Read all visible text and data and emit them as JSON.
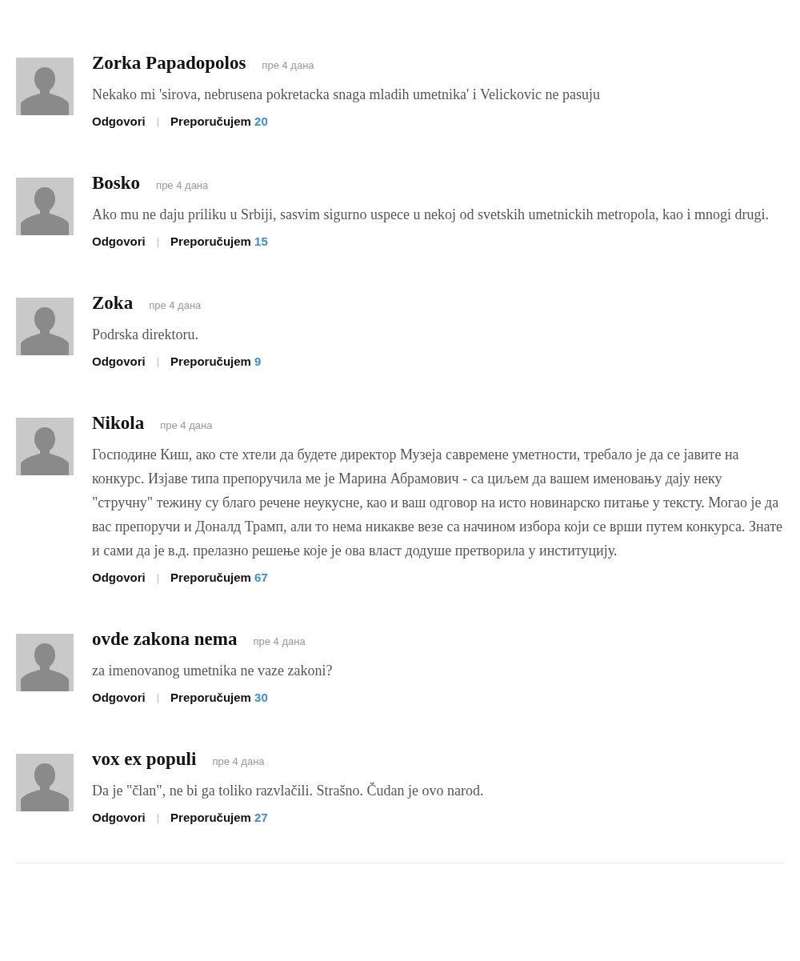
{
  "comments": [
    {
      "author": "Zorka Papadopolos",
      "time": "пре 4 дана",
      "text": "Nekako mi 'sirova, nebrusena pokretacka snaga mladih umetnika' i Velickovic ne pasuju",
      "reply": "Odgovori",
      "separator": "|",
      "recommend": "Preporučujem",
      "count": "20"
    },
    {
      "author": "Bosko",
      "time": "пре 4 дана",
      "text": "Ako mu ne daju priliku u Srbiji, sasvim sigurno uspece u nekoj od svetskih umetnickih metropola, kao i mnogi drugi.",
      "reply": "Odgovori",
      "separator": "|",
      "recommend": "Preporučujem",
      "count": "15"
    },
    {
      "author": "Zoka",
      "time": "пре 4 дана",
      "text": "Podrska direktoru.",
      "reply": "Odgovori",
      "separator": "|",
      "recommend": "Preporučujem",
      "count": "9"
    },
    {
      "author": "Nikola",
      "time": "пре 4 дана",
      "text": "Господине Киш, ако сте хтели да будете директор Музеја савремене уметности, требало је да се јавите на конкурс. Изјаве типа препоручила ме је Марина Абрамович - са циљем да вашем именовању дају неку \"стручну\" тежину су благо речене неукусне, као и ваш одговор на исто новинарско питање у тексту. Могао је да вас препоручи и Доналд Трамп, али то нема никакве везе са начином избора који се врши путем конкурса. Знате и сами да је в.д. прелазно решење које је ова власт додуше претворила у институцију.",
      "reply": "Odgovori",
      "separator": "|",
      "recommend": "Preporučujem",
      "count": "67"
    },
    {
      "author": "ovde zakona nema",
      "time": "пре 4 дана",
      "text": "za imenovanog umetnika ne vaze zakoni?",
      "reply": "Odgovori",
      "separator": "|",
      "recommend": "Preporučujem",
      "count": "30"
    },
    {
      "author": "vox ex populi",
      "time": "пре 4 дана",
      "text": "Da je \"član\", ne bi ga toliko razvlačili. Strašno. Čudan je ovo narod.",
      "reply": "Odgovori",
      "separator": "|",
      "recommend": "Preporučujem",
      "count": "27"
    }
  ]
}
